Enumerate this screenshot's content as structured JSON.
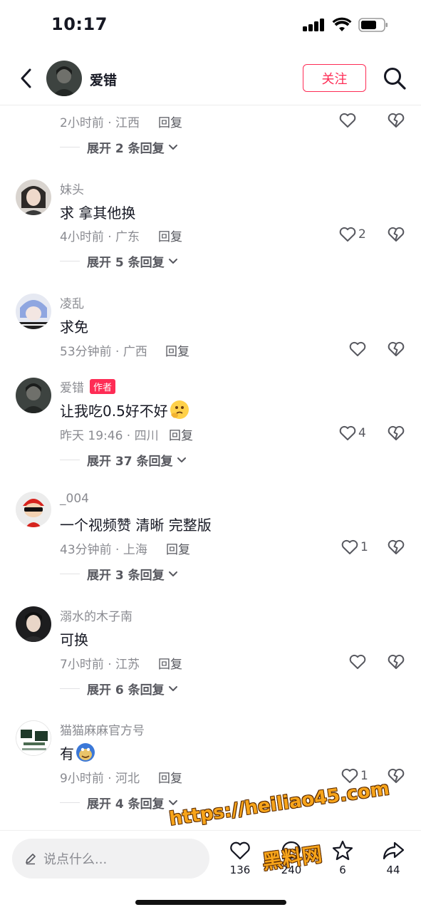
{
  "status_bar": {
    "time": "10:17"
  },
  "header": {
    "username": "爱错",
    "follow_label": "关注"
  },
  "comments": [
    {
      "name": "",
      "text": "",
      "time_location": "2小时前 · 江西",
      "reply_label": "回复",
      "likes": "",
      "expand_label": "展开 2 条回复"
    },
    {
      "name": "妹头",
      "text": "求  拿其他换",
      "time_location": "4小时前 · 广东",
      "reply_label": "回复",
      "likes": "2",
      "expand_label": "展开 5 条回复"
    },
    {
      "name": "凌乱",
      "text": "求免",
      "time_location": "53分钟前 · 广西",
      "reply_label": "回复",
      "likes": "",
      "expand_label": ""
    },
    {
      "name": "爱错",
      "badge": "作者",
      "text": "让我吃0.5好不好",
      "time_location": "昨天 19:46 · 四川",
      "reply_label": "回复",
      "likes": "4",
      "expand_label": "展开 37 条回复"
    },
    {
      "name": "_004",
      "text": "一个视频赞 清晰 完整版",
      "time_location": "43分钟前 · 上海",
      "reply_label": "回复",
      "likes": "1",
      "expand_label": "展开 3 条回复"
    },
    {
      "name": "溺水的木子南",
      "text": "可换",
      "time_location": "7小时前 · 江苏",
      "reply_label": "回复",
      "likes": "",
      "expand_label": "展开 6 条回复"
    },
    {
      "name": "猫猫麻麻官方号",
      "text": "有",
      "time_location": "9小时前 · 河北",
      "reply_label": "回复",
      "likes": "1",
      "expand_label": "展开 4 条回复"
    }
  ],
  "bottom_bar": {
    "input_placeholder": "说点什么...",
    "like_count": "136",
    "comment_count": "240",
    "favorite_count": "6",
    "share_count": "44"
  },
  "watermark": {
    "url": "https://heiliao45.com",
    "name": "黑料网"
  },
  "colors": {
    "accent": "#fe2c55",
    "secondary_text": "#8a8b91"
  }
}
